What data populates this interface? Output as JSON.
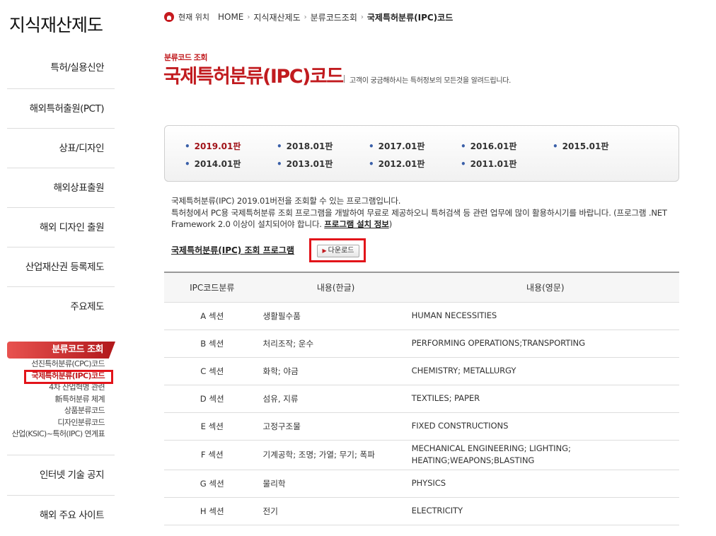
{
  "sidebar": {
    "title": "지식재산제도",
    "menu_top": [
      "특허/실용신안",
      "해외특허출원(PCT)",
      "상표/디자인",
      "해외상표출원",
      "해외 디자인 출원",
      "산업재산권 등록제도",
      "주요제도"
    ],
    "active_section": "분류코드 조회",
    "sub_items": [
      "선진특허분류(CPC)코드",
      "국제특허분류(IPC)코드",
      "4차 산업혁명 관련",
      "新특허분류 체계",
      "상품분류코드",
      "디자인분류코드",
      "산업(KSIC)~특허(IPC) 연계표"
    ],
    "menu_bottom": [
      "인터넷 기술 공지",
      "해외 주요 사이트"
    ]
  },
  "breadcrumb": {
    "label": "현재 위치",
    "items": [
      "HOME",
      "지식재산제도",
      "분류코드조회",
      "국제특허분류(IPC)코드"
    ]
  },
  "header": {
    "kicker": "분류코드 조회",
    "title": "국제특허분류(IPC)코드",
    "description": "고객이 궁금해하시는 특허정보의 모든것을 알려드립니다."
  },
  "versions": [
    "2019.01판",
    "2018.01판",
    "2017.01판",
    "2016.01판",
    "2015.01판",
    "2014.01판",
    "2013.01판",
    "2012.01판",
    "2011.01판"
  ],
  "description": {
    "line1": "국제특허분류(IPC) 2019.01버전을 조회할 수 있는 프로그램입니다.",
    "line2": "특허청에서 PC용 국제특허분류 조회 프로그램을 개발하여 무료로 제공하오니 특허검색 등 관련 업무에 많이 활용하시기를 바랍니다. (프로그램 .NET Framework 2.0 이상이 설치되어야 합니다.",
    "link": "프로그램 설치 정보",
    "close": ")"
  },
  "program": {
    "label": "국제특허분류(IPC) 조회 프로그램",
    "download": "다운로드"
  },
  "table": {
    "headers": [
      "IPC코드분류",
      "내용(한글)",
      "내용(영문)"
    ],
    "rows": [
      [
        "A 섹션",
        "생활필수품",
        "HUMAN NECESSITIES"
      ],
      [
        "B 섹션",
        "처리조작; 운수",
        "PERFORMING OPERATIONS;TRANSPORTING"
      ],
      [
        "C 섹션",
        "화학; 야금",
        "CHEMISTRY; METALLURGY"
      ],
      [
        "D 섹션",
        "섬유, 지류",
        "TEXTILES; PAPER"
      ],
      [
        "E 섹션",
        "고정구조물",
        "FIXED CONSTRUCTIONS"
      ],
      [
        "F 섹션",
        "기계공학; 조명; 가열; 무기; 폭파",
        "MECHANICAL ENGINEERING; LIGHTING; HEATING;WEAPONS;BLASTING"
      ],
      [
        "G 섹션",
        "물리학",
        "PHYSICS"
      ],
      [
        "H 섹션",
        "전기",
        "ELECTRICITY"
      ]
    ]
  }
}
